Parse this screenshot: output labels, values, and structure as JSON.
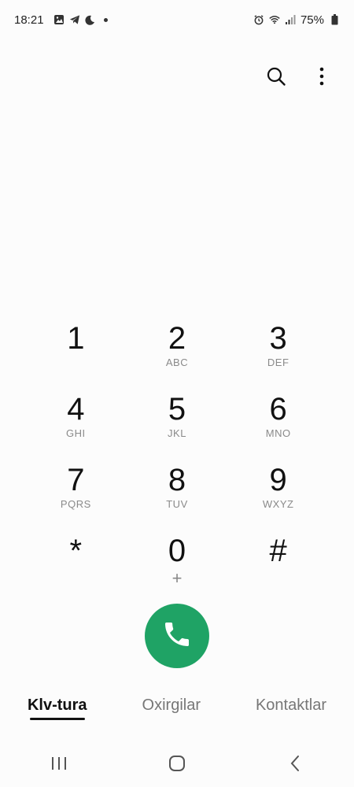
{
  "status_bar": {
    "time": "18:21",
    "battery": "75%",
    "icons_left": [
      "gallery-icon",
      "telegram-icon",
      "moon-icon",
      "dot-icon"
    ],
    "icons_right": [
      "alarm-icon",
      "wifi-icon",
      "signal-icon",
      "battery-icon"
    ]
  },
  "top_actions": {
    "search_icon": "search-icon",
    "more_icon": "more-vertical-icon"
  },
  "keypad": {
    "keys": [
      {
        "digit": "1",
        "letters": ""
      },
      {
        "digit": "2",
        "letters": "ABC"
      },
      {
        "digit": "3",
        "letters": "DEF"
      },
      {
        "digit": "4",
        "letters": "GHI"
      },
      {
        "digit": "5",
        "letters": "JKL"
      },
      {
        "digit": "6",
        "letters": "MNO"
      },
      {
        "digit": "7",
        "letters": "PQRS"
      },
      {
        "digit": "8",
        "letters": "TUV"
      },
      {
        "digit": "9",
        "letters": "WXYZ"
      },
      {
        "digit": "*",
        "letters": ""
      },
      {
        "digit": "0",
        "letters": "+"
      },
      {
        "digit": "#",
        "letters": ""
      }
    ]
  },
  "call_button": {
    "icon": "phone-icon",
    "color": "#1fa365"
  },
  "tabs": [
    {
      "label": "Klv-tura",
      "active": true
    },
    {
      "label": "Oxirgilar",
      "active": false
    },
    {
      "label": "Kontaktlar",
      "active": false
    }
  ],
  "nav_bar": {
    "icons": [
      "recent-apps-icon",
      "home-icon",
      "back-icon"
    ]
  }
}
